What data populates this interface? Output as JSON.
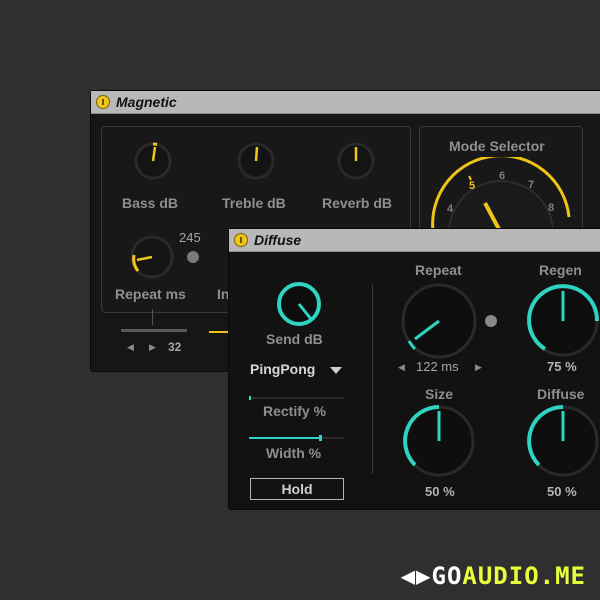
{
  "magnetic": {
    "title": "Magnetic",
    "knobs": [
      {
        "label": "Bass dB"
      },
      {
        "label": "Treble dB"
      },
      {
        "label": "Reverb dB"
      }
    ],
    "repeat_label": "Repeat ms",
    "repeat_value": "245",
    "input_label_partial": "In",
    "bottom_value": "32",
    "mode_selector": {
      "title": "Mode Selector",
      "numbers": [
        "4",
        "5",
        "6",
        "7",
        "8"
      ],
      "selected": "5"
    }
  },
  "diffuse": {
    "title": "Diffuse",
    "send_label": "Send dB",
    "mode_dropdown": "PingPong",
    "rectify_label": "Rectify %",
    "width_label": "Width %",
    "hold_label": "Hold",
    "repeat": {
      "label": "Repeat",
      "value": "122 ms"
    },
    "regen": {
      "label": "Regen",
      "value": "75 %"
    },
    "size": {
      "label": "Size",
      "value": "50 %"
    },
    "diffuse_knob": {
      "label": "Diffuse",
      "value": "50 %"
    }
  },
  "watermark": {
    "text_left": "GO",
    "text_right": "AUDIO.ME"
  },
  "colors": {
    "accent_yellow": "#f0c419",
    "accent_teal": "#2fd3c1",
    "background": "#2f2f2f",
    "panel": "#161616"
  }
}
